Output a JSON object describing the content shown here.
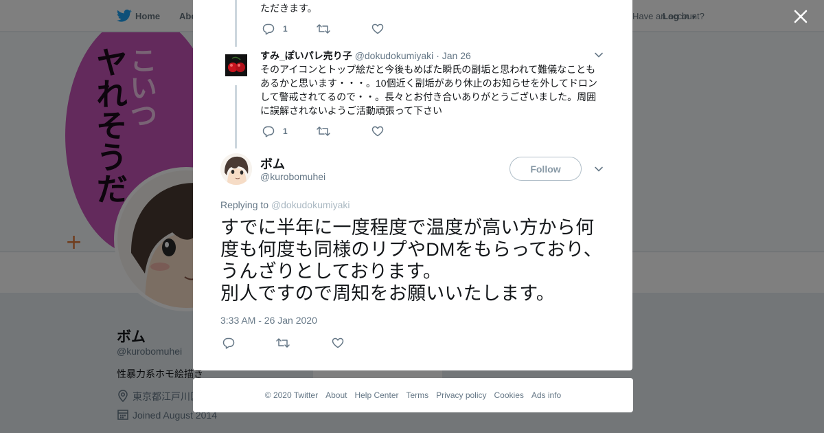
{
  "topnav": {
    "home_label": "Home",
    "about_label": "About",
    "have_account_label": "Have an account?",
    "login_label": "Log in"
  },
  "banner": {
    "art_text_1": "こいつ",
    "art_text_2": "ヤれそうだ"
  },
  "profile": {
    "name": "ボム",
    "handle": "@kurobomuhei",
    "bio": "性暴力系ホモ絵描き",
    "location": "東京都江戸川区",
    "joined": "Joined August 2014",
    "follow_label": "Follow"
  },
  "thread": {
    "tweet1": {
      "text_tail": "ただきます。",
      "reply_count": "1"
    },
    "tweet2": {
      "name": "すみ_ぽいパレ売り子",
      "handle": "@dokudokumiyaki",
      "date": "· Jan 26",
      "text": "そのアイコンとトップ絵だと今後もめばた瞬氏の副垢と思われて難儀なこともあるかと思います・・・。10個近く副垢があり休止のお知らせを外してドロンして警戒されてるので・・。長々とお付き合いありがとうございました。周囲に誤解されないようご活動頑張って下さい",
      "reply_count": "1"
    }
  },
  "main_tweet": {
    "name": "ボム",
    "handle": "@kurobomuhei",
    "follow_label": "Follow",
    "replying_prefix": "Replying to",
    "replying_to": "@dokudokumiyaki",
    "text": "すでに半年に一度程度で温度が高い方から何度も何度も同様のリプやDMをもらっており、うんざりとしております。\n別人ですので周知をお願いいたします。",
    "timestamp": "3:33 AM - 26 Jan 2020"
  },
  "footer": {
    "copyright": "© 2020 Twitter",
    "links": [
      "About",
      "Help Center",
      "Terms",
      "Privacy policy",
      "Cookies",
      "Ads info"
    ]
  },
  "colors": {
    "brand_blue": "#1da1f2",
    "text_primary": "#14171a",
    "text_secondary": "#657786",
    "banner_pink": "#c654b8"
  }
}
